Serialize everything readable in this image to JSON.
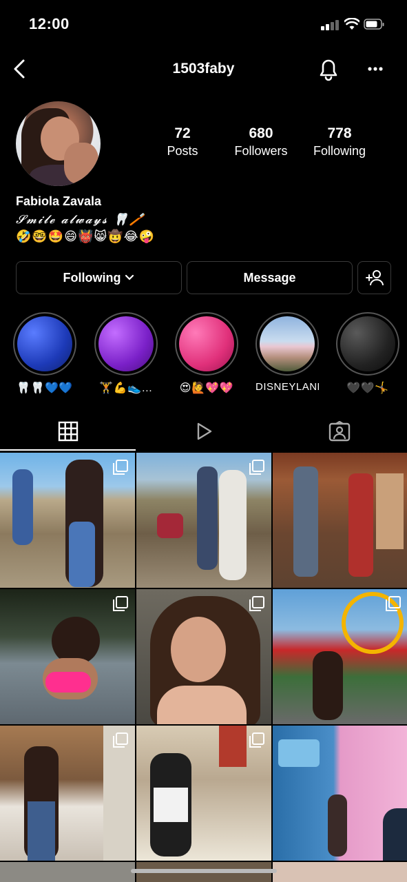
{
  "status_bar": {
    "time": "12:00"
  },
  "header": {
    "username": "1503faby"
  },
  "profile": {
    "stats": [
      {
        "value": "72",
        "label": "Posts"
      },
      {
        "value": "680",
        "label": "Followers"
      },
      {
        "value": "778",
        "label": "Following"
      }
    ],
    "name": "Fabiola Zavala",
    "bio_line1": "𝓢𝓶𝓲𝓵𝓮 𝓪𝓵𝔀𝓪𝔂𝓼 🦷🪥",
    "bio_line2": "🤣🤓🤩😄👹😸🤠😂🤪"
  },
  "actions": {
    "following_label": "Following",
    "message_label": "Message"
  },
  "highlights": [
    {
      "label": "🦷🦷💙💙",
      "color": "#2a4fd6"
    },
    {
      "label": "🏋️💪👟…",
      "color": "#8a2bd6"
    },
    {
      "label": "😍🙋💖💖",
      "color": "#e0307a"
    },
    {
      "label": "DISNEYLAND",
      "color": "#9bb8d8"
    },
    {
      "label": "🖤🖤🤸",
      "color": "#2a2a2a"
    }
  ],
  "tabs": [
    {
      "name": "grid-tab",
      "active": true
    },
    {
      "name": "reels-tab",
      "active": false
    },
    {
      "name": "tagged-tab",
      "active": false
    }
  ],
  "colors": {
    "background": "#000000",
    "border": "#3a3a3a",
    "text": "#ffffff"
  }
}
